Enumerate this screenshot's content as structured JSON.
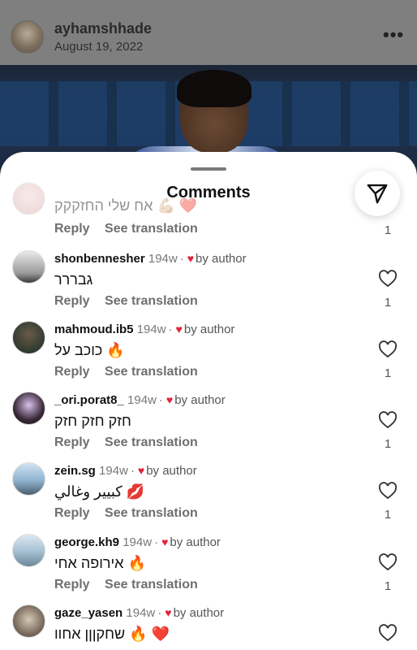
{
  "post": {
    "username": "ayhamshhade",
    "date": "August 19, 2022",
    "more_icon": "more-horizontal-icon"
  },
  "sheet": {
    "title": "Comments",
    "send_icon": "send-paper-plane-icon"
  },
  "actions": {
    "reply": "Reply",
    "see_translation": "See translation"
  },
  "comments": [
    {
      "username": "",
      "time": "",
      "by_author": "",
      "text": "אח שלי החזקקק 💪🏼 ❤️",
      "likes": "1"
    },
    {
      "username": "shonbennesher",
      "time": "194w",
      "by_author": "by author",
      "text": "גבררר",
      "likes": "1"
    },
    {
      "username": "mahmoud.ib5",
      "time": "194w",
      "by_author": "by author",
      "text": "כוכב על 🔥",
      "likes": "1"
    },
    {
      "username": "_ori.porat8_",
      "time": "194w",
      "by_author": "by author",
      "text": "חזק חזק חזק",
      "likes": "1"
    },
    {
      "username": "zein.sg",
      "time": "194w",
      "by_author": "by author",
      "text": "كبيير وغالي 💋",
      "likes": "1"
    },
    {
      "username": "george.kh9",
      "time": "194w",
      "by_author": "by author",
      "text": "אירופה אחי 🔥",
      "likes": "1"
    },
    {
      "username": "gaze_yasen",
      "time": "194w",
      "by_author": "by author",
      "text": "שחקןןן אחוו 🔥 ❤️",
      "likes": ""
    }
  ],
  "colors": {
    "like_red": "#e0243c",
    "sheet_bg": "#ffffff",
    "dim_bg": "#7f7f7f"
  }
}
